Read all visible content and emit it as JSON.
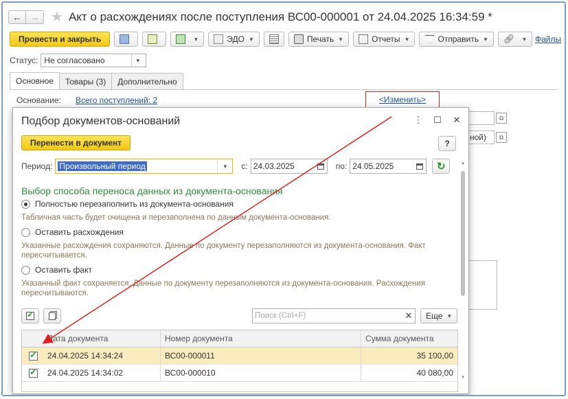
{
  "window": {
    "title": "Акт о расхождениях после поступления ВС00-000001 от 24.04.2025 16:34:59 *"
  },
  "toolbar": {
    "post_close": "Провести и закрыть",
    "edo": "ЭДО",
    "print": "Печать",
    "reports": "Отчеты",
    "send": "Отправить",
    "files": "Файлы"
  },
  "status": {
    "label": "Статус:",
    "value": "Не согласовано"
  },
  "tabs": [
    {
      "label": "Основное"
    },
    {
      "label": "Товары (3)"
    },
    {
      "label": "Дополнительно"
    }
  ],
  "basis": {
    "label": "Основание:",
    "link": "Всего поступлений: 2",
    "change": "<Изменить>"
  },
  "bg_fields": {
    "partial_text": "ной)"
  },
  "dialog": {
    "title": "Подбор документов-оснований",
    "transfer_button": "Перенести в документ",
    "help": "?",
    "period_label": "Период:",
    "period_value": "Произвольный период",
    "from_label": "с:",
    "from_date": "24.03.2025",
    "to_label": "по:",
    "to_date": "24.05.2025",
    "section_title": "Выбор способа переноса данных из документа-основания",
    "options": [
      {
        "label": "Полностью перезаполнить из документа-основания",
        "hint": "Табличная часть будет очищена и перезаполнена по данным документа-основания.",
        "selected": true
      },
      {
        "label": "Оставить расхождения",
        "hint": "Указанные расхождения сохраняются. Данные по документу перезаполняются из документа-основания. Факт пересчитывается.",
        "selected": false
      },
      {
        "label": "Оставить факт",
        "hint": "Указанный факт сохраняется. Данные по документу перезаполняются из документа-основания. Расхождения пересчитываются.",
        "selected": false
      }
    ],
    "search_placeholder": "Поиск (Ctrl+F)",
    "more": "Еще",
    "table": {
      "headers": [
        "Дата документа",
        "Номер документа",
        "Сумма документа"
      ],
      "rows": [
        {
          "checked": true,
          "date": "24.04.2025 14:34:24",
          "number": "ВС00-000011",
          "sum": "35 100,00"
        },
        {
          "checked": true,
          "date": "24.04.2025 14:34:02",
          "number": "ВС00-000010",
          "sum": "40 080,00"
        }
      ]
    }
  },
  "colors": {
    "primary_button": "#f5d53a",
    "link": "#1c4f9a",
    "section_title": "#2f8d3e",
    "annotation": "#e02020",
    "selected_row": "#fbecc0"
  }
}
